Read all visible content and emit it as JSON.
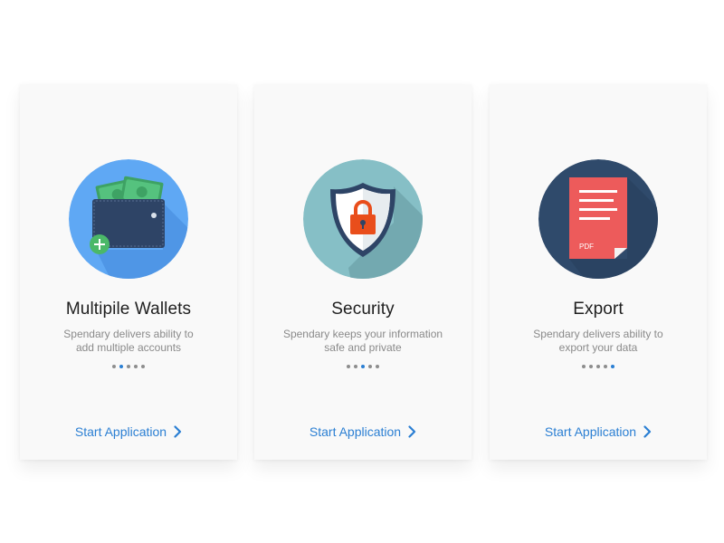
{
  "cards": [
    {
      "title": "Multipile Wallets",
      "description_line1": "Spendary delivers ability to",
      "description_line2": "add multiple accounts",
      "active_page": 2,
      "page_count": 5,
      "cta_label": "Start Application",
      "icon": "wallet-icon",
      "circle_color": "#5fa8f4"
    },
    {
      "title": "Security",
      "description_line1": "Spendary keeps your information",
      "description_line2": "safe and private",
      "active_page": 3,
      "page_count": 5,
      "cta_label": "Start Application",
      "icon": "shield-lock-icon",
      "circle_color": "#86bfc6"
    },
    {
      "title": "Export",
      "description_line1": "Spendary delivers ability to",
      "description_line2": "export your data",
      "active_page": 5,
      "page_count": 5,
      "cta_label": "Start Application",
      "icon": "pdf-document-icon",
      "pdf_label": "PDF",
      "circle_color": "#2f4a6b"
    }
  ],
  "accent_color": "#2b7fd3"
}
